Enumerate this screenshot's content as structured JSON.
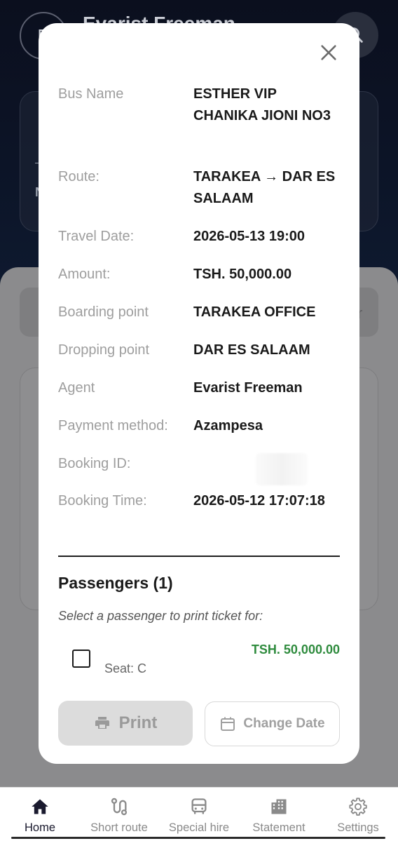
{
  "background": {
    "avatar_initial": "E",
    "user_name": "Evarist Freeman",
    "card_letter": "N",
    "search_field_tail": "r"
  },
  "modal": {
    "details": [
      {
        "label": "Bus Name",
        "value": "ESTHER VIP CHANIKA JIONI NO3"
      },
      {
        "label": "Route:",
        "value": "TARAKEA → DAR ES SALAAM"
      },
      {
        "label": "Travel Date:",
        "value": "2026-05-13 19:00"
      },
      {
        "label": "Amount:",
        "value": "TSH. 50,000.00"
      },
      {
        "label": "Boarding point",
        "value": "TARAKEA OFFICE"
      },
      {
        "label": "Dropping point",
        "value": "DAR ES SALAAM"
      },
      {
        "label": "Agent",
        "value": "Evarist Freeman"
      },
      {
        "label": "Payment method:",
        "value": "Azampesa"
      },
      {
        "label": "Booking ID:",
        "value": ""
      },
      {
        "label": "Booking Time:",
        "value": "2026-05-12 17:07:18"
      }
    ],
    "passengers_title": "Passengers (1)",
    "passengers_subtitle": "Select a passenger to print ticket for:",
    "passenger": {
      "seat": "Seat: C",
      "amount": "TSH. 50,000.00"
    },
    "print_label": "Print",
    "change_date_label": "Change Date"
  },
  "nav": [
    {
      "label": "Home",
      "icon": "home-icon"
    },
    {
      "label": "Short route",
      "icon": "route-icon"
    },
    {
      "label": "Special hire",
      "icon": "bus-icon"
    },
    {
      "label": "Statement",
      "icon": "building-icon"
    },
    {
      "label": "Settings",
      "icon": "gear-icon"
    }
  ],
  "colors": {
    "accent_green": "#2e8b3d",
    "header_dark": "#0c1427"
  }
}
